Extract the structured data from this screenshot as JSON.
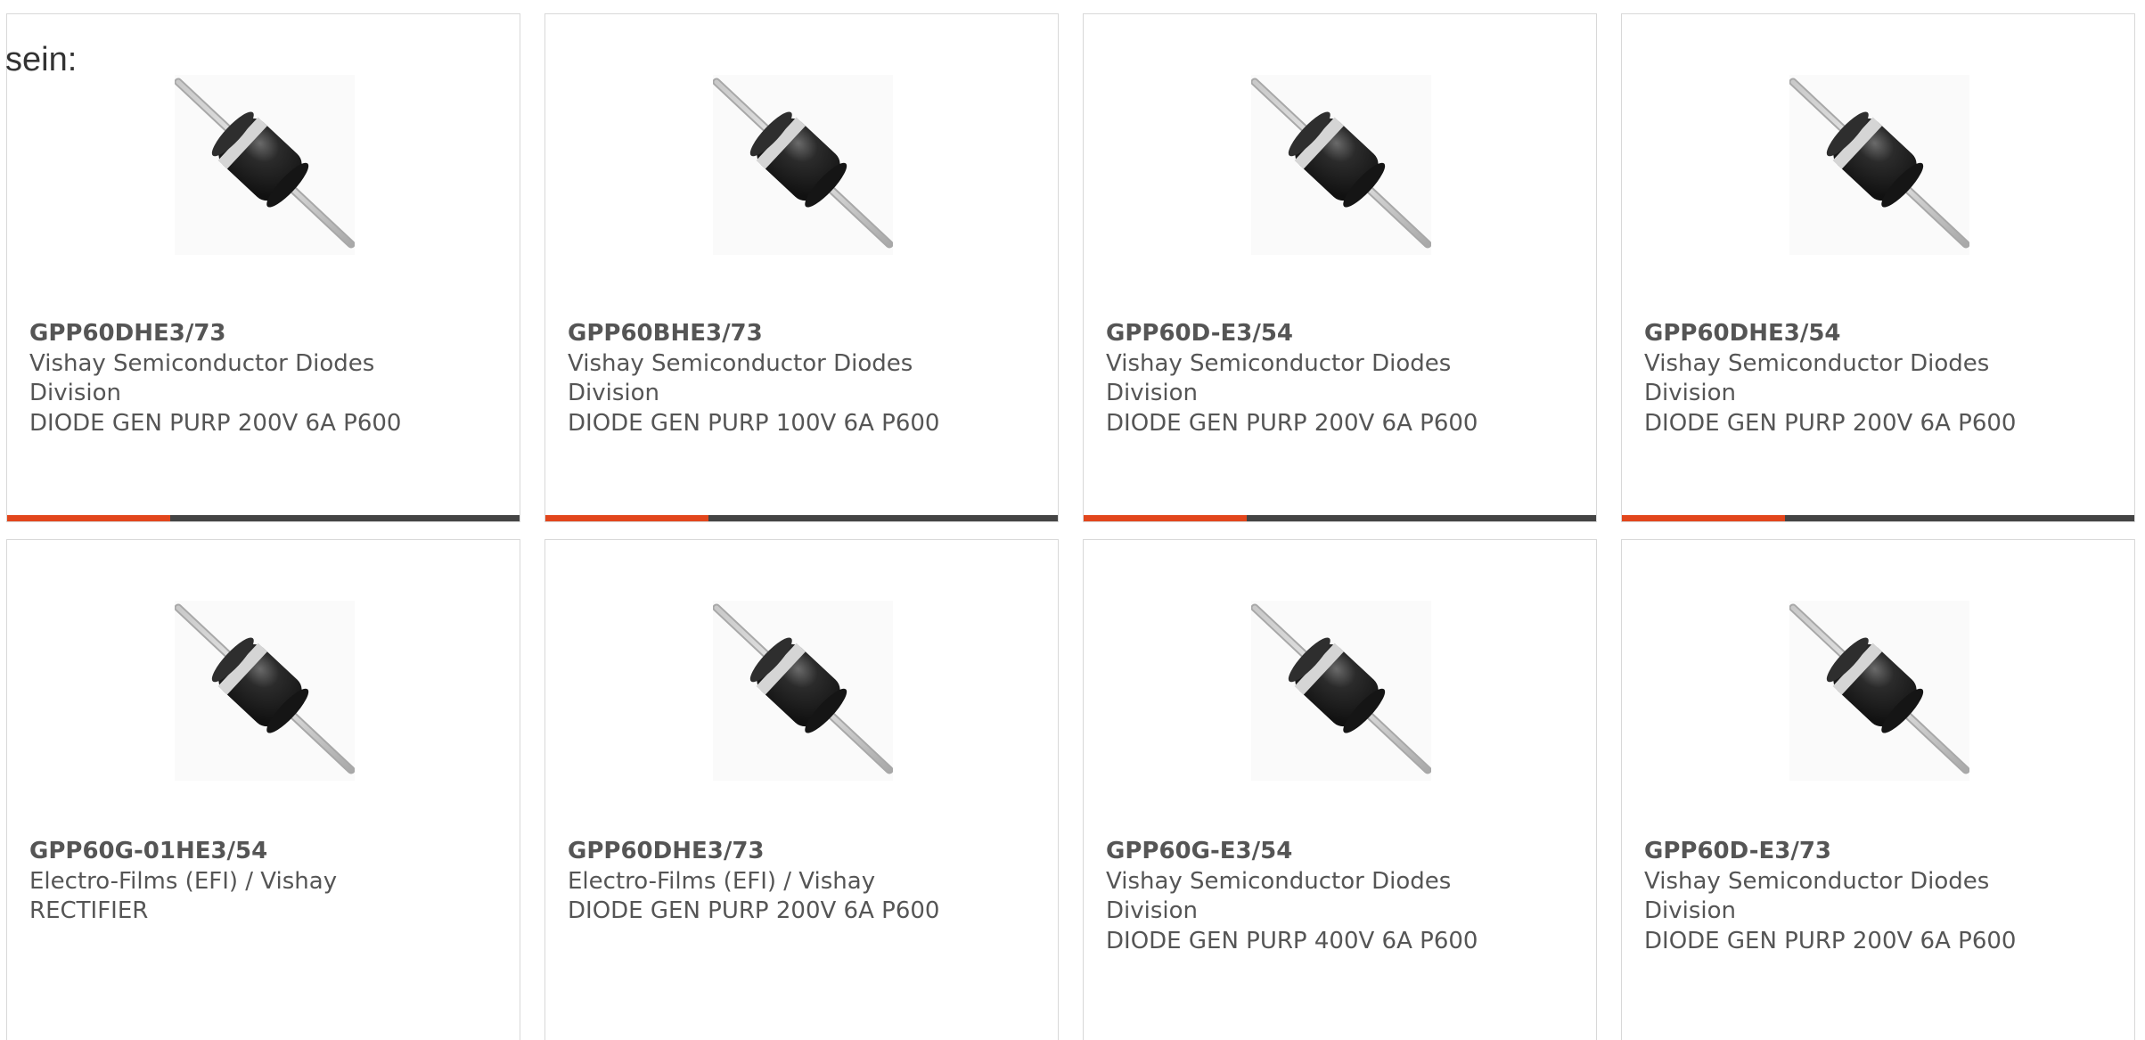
{
  "intro": {
    "text": "sein:"
  },
  "colors": {
    "accent": "#e2461c",
    "bar": "#444444",
    "text": "#555555",
    "border": "#d8d8d8"
  },
  "products": [
    {
      "part": "GPP60DHE3/73",
      "manufacturer": "Vishay Semiconductor Diodes Division",
      "description": "DIODE GEN PURP 200V 6A P600",
      "image_icon": "axial-diode-icon"
    },
    {
      "part": "GPP60BHE3/73",
      "manufacturer": "Vishay Semiconductor Diodes Division",
      "description": "DIODE GEN PURP 100V 6A P600",
      "image_icon": "axial-diode-icon"
    },
    {
      "part": "GPP60D-E3/54",
      "manufacturer": "Vishay Semiconductor Diodes Division",
      "description": "DIODE GEN PURP 200V 6A P600",
      "image_icon": "axial-diode-icon"
    },
    {
      "part": "GPP60DHE3/54",
      "manufacturer": "Vishay Semiconductor Diodes Division",
      "description": "DIODE GEN PURP 200V 6A P600",
      "image_icon": "axial-diode-icon"
    },
    {
      "part": "GPP60G-01HE3/54",
      "manufacturer": "Electro-Films (EFI) / Vishay",
      "description": "RECTIFIER",
      "image_icon": "axial-diode-icon"
    },
    {
      "part": "GPP60DHE3/73",
      "manufacturer": "Electro-Films (EFI) / Vishay",
      "description": "DIODE GEN PURP 200V 6A P600",
      "image_icon": "axial-diode-icon"
    },
    {
      "part": "GPP60G-E3/54",
      "manufacturer": "Vishay Semiconductor Diodes Division",
      "description": "DIODE GEN PURP 400V 6A P600",
      "image_icon": "axial-diode-icon"
    },
    {
      "part": "GPP60D-E3/73",
      "manufacturer": "Vishay Semiconductor Diodes Division",
      "description": "DIODE GEN PURP 200V 6A P600",
      "image_icon": "axial-diode-icon"
    }
  ]
}
